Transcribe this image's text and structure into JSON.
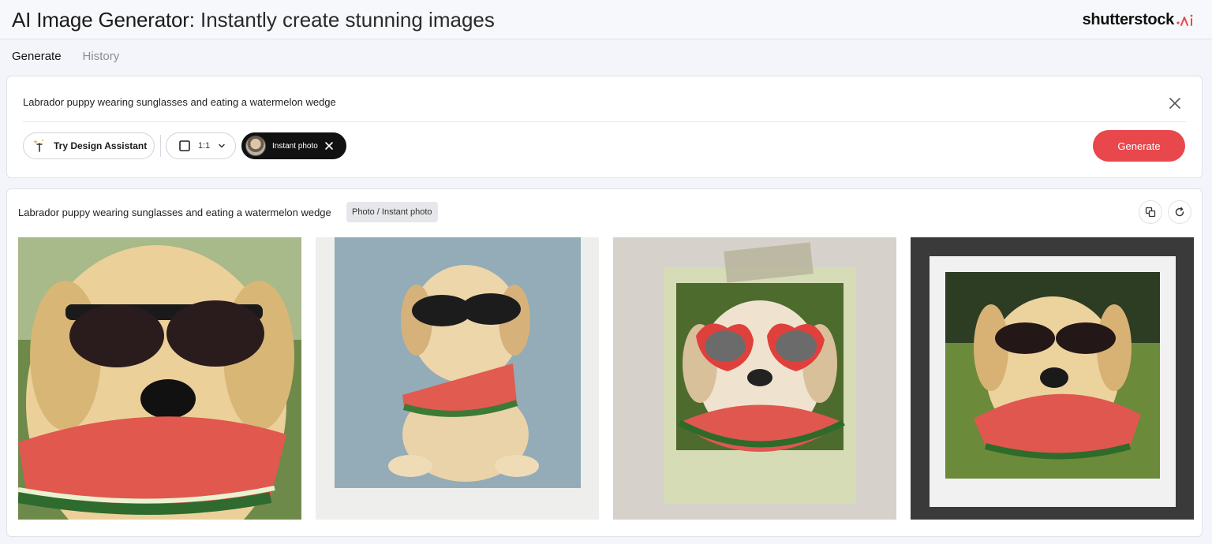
{
  "header": {
    "title_bold": "AI Image Generator:",
    "title_rest": " Instantly create stunning images",
    "logo_text": "shutterstock",
    "logo_mark": ".ai"
  },
  "tabs": [
    {
      "label": "Generate",
      "active": true
    },
    {
      "label": "History",
      "active": false
    }
  ],
  "prompt": {
    "text": "Labrador puppy wearing sunglasses and eating a watermelon wedge",
    "design_assistant_label": "Try Design Assistant",
    "ratio_label": "1:1",
    "style_label": "Instant photo",
    "generate_label": "Generate"
  },
  "results": {
    "prompt_text": "Labrador puppy wearing sunglasses and eating a watermelon wedge",
    "style_badge": "Photo / Instant photo",
    "images": [
      {
        "name": "result-image-1",
        "subject": "close-up puppy with dark sunglasses eating watermelon"
      },
      {
        "name": "result-image-2",
        "subject": "instant photo of sitting puppy with sunglasses holding watermelon"
      },
      {
        "name": "result-image-3",
        "subject": "instant photo taped to wall, puppy with red heart sunglasses"
      },
      {
        "name": "result-image-4",
        "subject": "instant photo frame, puppy with sunglasses eating watermelon outdoors"
      }
    ]
  },
  "colors": {
    "accent": "#e8474c",
    "logo_ai": "#e8474c",
    "style_pill_bg": "#111111"
  },
  "icons": [
    "close-icon",
    "sparkle-wand-icon",
    "square-ratio-icon",
    "chevron-down-icon",
    "compare-icon",
    "refresh-icon"
  ]
}
